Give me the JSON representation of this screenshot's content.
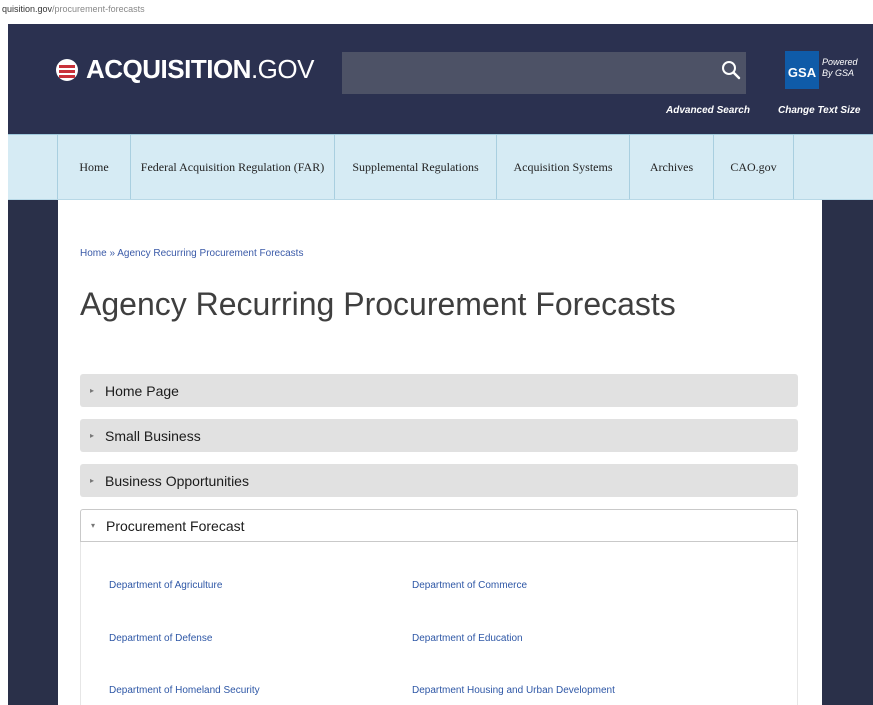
{
  "browser": {
    "url_prefix": "quisition.gov",
    "url_path": "/procurement-forecasts"
  },
  "header": {
    "logo_bold": "ACQUISITION",
    "logo_light": ".GOV",
    "advanced_search": "Advanced Search",
    "gsa_badge": "GSA",
    "powered_line1": "Powered",
    "powered_line2": "By GSA",
    "change_text_size": "Change Text Size"
  },
  "nav": {
    "items": [
      {
        "label": "Home"
      },
      {
        "label": "Federal Acquisition Regulation (FAR)"
      },
      {
        "label": "Supplemental Regulations"
      },
      {
        "label": "Acquisition Systems"
      },
      {
        "label": "Archives"
      },
      {
        "label": "CAO.gov"
      }
    ]
  },
  "breadcrumb": {
    "home": "Home",
    "separator": "»",
    "current": "Agency Recurring Procurement Forecasts"
  },
  "page_title": "Agency Recurring Procurement Forecasts",
  "accordion": [
    {
      "label": "Home Page",
      "state": "collapsed"
    },
    {
      "label": "Small Business",
      "state": "collapsed"
    },
    {
      "label": "Business Opportunities",
      "state": "collapsed"
    },
    {
      "label": "Procurement Forecast",
      "state": "expanded"
    }
  ],
  "departments": [
    "Department of Agriculture",
    "Department of Commerce",
    "Department of Defense",
    "Department of Education",
    "Department of Homeland Security",
    "Department Housing and Urban Development"
  ],
  "icons": {
    "caret_collapsed": "▸",
    "caret_expanded": "▾"
  },
  "colors": {
    "header_bg": "#2b3150",
    "nav_bg": "#d6ebf4",
    "link": "#2e57a6",
    "gsa_blue": "#0f5ba8"
  }
}
